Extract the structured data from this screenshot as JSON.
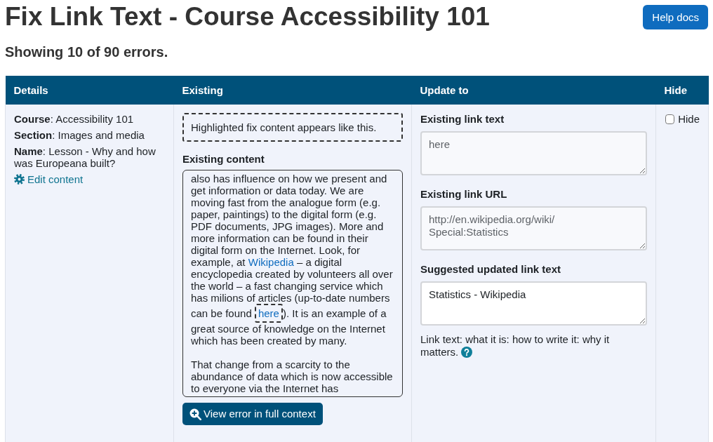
{
  "page": {
    "title": "Fix Link Text - Course Accessibility 101",
    "summary": "Showing 10 of 90 errors.",
    "help_button": "Help docs"
  },
  "table": {
    "columns": [
      "Details",
      "Existing",
      "Update to",
      "Hide"
    ],
    "rows": [
      {
        "details": {
          "fields": [
            "**Course**: Accessibility 101",
            "**Section**: Images and media",
            "**Name**: Lesson - Why and how was Europeana built?"
          ],
          "edit_link": "Edit content"
        },
        "existing": {
          "legend": "Highlighted fix content appears like this.",
          "content_label": "Existing content",
          "paragraphs": [
            {
              "segments": [
                {
                  "kind": "text",
                  "text": "also has influence on how we present and get information or data today. We are moving fast from the analogue form (e.g. paper, paintings) to the digital form (e.g. PDF documents, JPG images). More and more information can be found in their digital form on the Internet. Look, for example, at "
                },
                {
                  "kind": "link",
                  "text": "Wikipedia",
                  "highlighted": false
                },
                {
                  "kind": "text",
                  "text": " – a digital encyclopedia created by volunteers all over the world – a fast changing service which has milions of articles (up-to-date numbers can be found "
                },
                {
                  "kind": "link",
                  "text": "here",
                  "highlighted": true
                },
                {
                  "kind": "text",
                  "text": "). It is an example of a great source of knowledge on the Internet which has been created by many."
                }
              ]
            },
            {
              "segments": [
                {
                  "kind": "text",
                  "text": "That change from a scarcity to the abundance of data which is now accessible to everyone via the Internet has"
                }
              ]
            }
          ],
          "view_button": "View error in full context"
        },
        "update": {
          "fields": [
            {
              "label": "Existing link text",
              "value": "here",
              "readonly": true
            },
            {
              "label": "Existing link URL",
              "value": "http://en.wikipedia.org/wiki/Special:Statistics",
              "readonly": true
            },
            {
              "label": "Suggested updated link text",
              "value": "Statistics - Wikipedia",
              "readonly": false
            }
          ],
          "help_text": "Link text: what it is: how to write it: why it matters."
        },
        "hide": {
          "label": "Hide",
          "checked": false
        }
      }
    ]
  }
}
